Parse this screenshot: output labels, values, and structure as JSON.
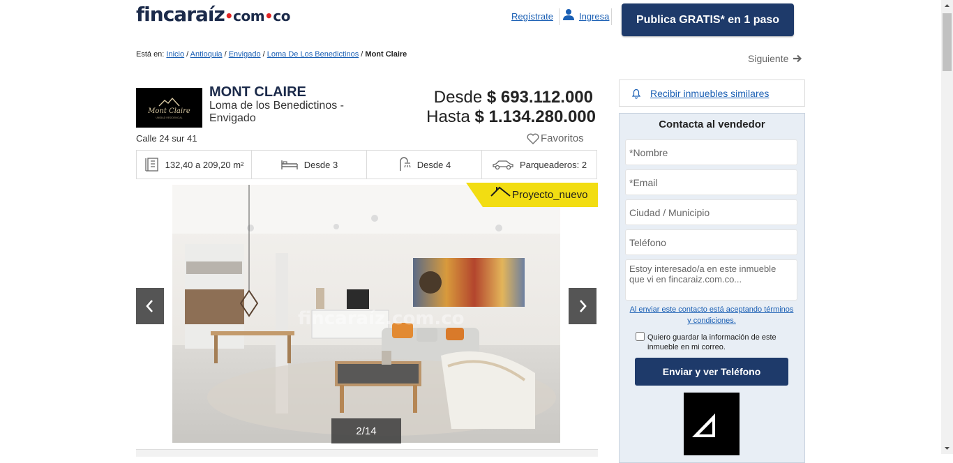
{
  "header": {
    "logo_main": "fincaraíz",
    "logo_dot1": "•",
    "logo_com": "com",
    "logo_dot2": "•",
    "logo_co": "co",
    "register": "Regístrate",
    "login": "Ingresa",
    "publish_button": "Publica GRATIS* en 1 paso"
  },
  "breadcrumb": {
    "prefix": "Está en:",
    "items": [
      "Inicio",
      "Antioquia",
      "Envigado",
      "Loma De Los Benedictinos"
    ],
    "current": "Mont Claire"
  },
  "next_link": "Siguiente",
  "project": {
    "title": "MONT CLAIRE",
    "subtitle": "Loma de los Benedictinos - Envigado",
    "price_from_label": "Desde",
    "price_from": "$ 693.112.000",
    "price_to_label": "Hasta",
    "price_to": "$ 1.134.280.000",
    "address": "Calle 24 sur 41",
    "favorites": "Favoritos",
    "logo_text": "Mont Claire",
    "logo_tagline": "UNIDAD RESIDENCIAL"
  },
  "features": {
    "area": "132,40 a 209,20 m²",
    "bedrooms": "Desde  3",
    "bathrooms": "Desde  4",
    "parking": "Parqueaderos: 2"
  },
  "gallery": {
    "badge": "Proyecto_nuevo",
    "counter": "2/14",
    "watermark": "fincaraíz.com.co"
  },
  "sidebar": {
    "alert_link": "Recibir inmuebles similares",
    "contact_title": "Contacta al vendedor",
    "name_placeholder": "*Nombre",
    "email_placeholder": "*Email",
    "city_placeholder": "Ciudad / Municipio",
    "phone_placeholder": "Teléfono",
    "message_placeholder": "Estoy interesado/a en este inmueble que vi en fincaraiz.com.co...",
    "terms": "Al enviar este contacto está aceptando términos y condiciones.",
    "save_info": "Quiero guardar la información de este inmueble en mi correo.",
    "send_button": "Enviar y ver Teléfono"
  },
  "colors": {
    "brand_navy": "#1e3a6a",
    "brand_red": "#e02424",
    "badge_yellow": "#f2dd12",
    "link_blue": "#1a5fb4"
  }
}
